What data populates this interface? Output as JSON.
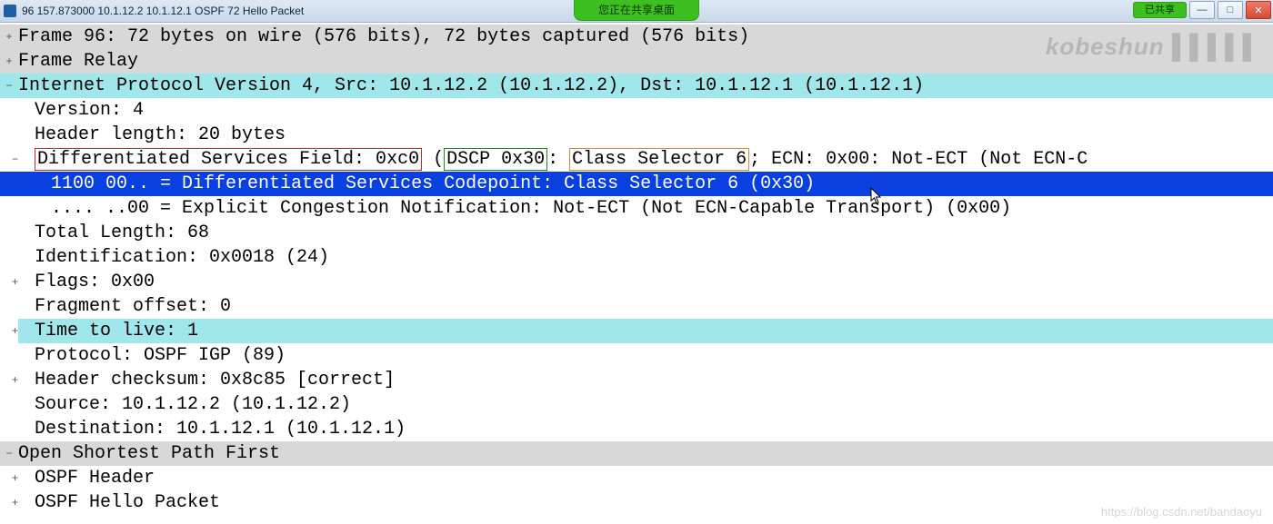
{
  "titlebar": {
    "title": "96 157.873000 10.1.12.2 10.1.12.1 OSPF 72 Hello Packet",
    "share_notice": "您正在共享桌面",
    "shared_badge": "已共享"
  },
  "watermarks": {
    "top_right": "kobeshun",
    "bottom_right": "https://blog.csdn.net/bandaoyu"
  },
  "tree": {
    "frame": {
      "text": "Frame 96: 72 bytes on wire (576 bits), 72 bytes captured (576 bits)",
      "toggle": "+"
    },
    "frame_relay": {
      "text": "Frame Relay",
      "toggle": "+"
    },
    "ip_header": {
      "text": "Internet Protocol Version 4, Src: 10.1.12.2 (10.1.12.2), Dst: 10.1.12.1 (10.1.12.1)",
      "toggle": "−"
    },
    "version": {
      "text": "Version: 4"
    },
    "hlen": {
      "text": "Header length: 20 bytes"
    },
    "dsf": {
      "toggle": "−",
      "label": "Differentiated Services Field: 0xc0",
      "dscp": "DSCP 0x30",
      "class": "Class Selector 6",
      "rest": "; ECN: 0x00: Not-ECT (Not ECN-C"
    },
    "dscp_line": {
      "text": "1100 00.. = Differentiated Services Codepoint: Class Selector 6 (0x30)"
    },
    "ecn_line": {
      "text": ".... ..00 = Explicit Congestion Notification: Not-ECT (Not ECN-Capable Transport) (0x00)"
    },
    "total_len": {
      "text": "Total Length: 68"
    },
    "ident": {
      "text": "Identification: 0x0018 (24)"
    },
    "flags": {
      "text": "Flags: 0x00",
      "toggle": "+"
    },
    "frag_off": {
      "text": "Fragment offset: 0"
    },
    "ttl": {
      "text": "Time to live: 1",
      "toggle": "+"
    },
    "protocol": {
      "text": "Protocol: OSPF IGP (89)"
    },
    "checksum": {
      "text": "Header checksum: 0x8c85 [correct]",
      "toggle": "+"
    },
    "source": {
      "text": "Source: 10.1.12.2 (10.1.12.2)"
    },
    "dest": {
      "text": "Destination: 10.1.12.1 (10.1.12.1)"
    },
    "ospf": {
      "text": "Open Shortest Path First",
      "toggle": "−"
    },
    "ospf_header": {
      "text": "OSPF Header",
      "toggle": "+"
    },
    "ospf_hello": {
      "text": "OSPF Hello Packet",
      "toggle": "+"
    }
  }
}
